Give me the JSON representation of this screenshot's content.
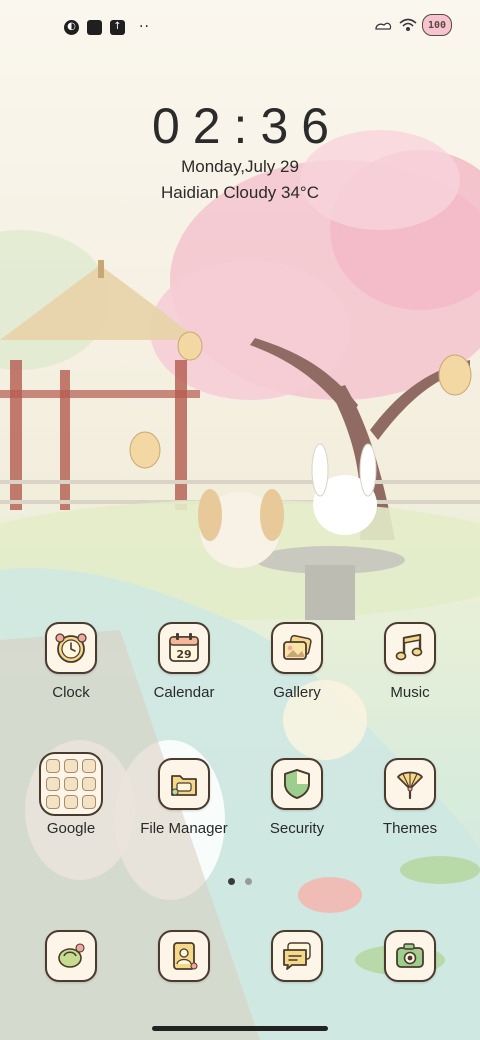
{
  "status_bar": {
    "left_icons": [
      "notification-app-icon",
      "square-app-icon",
      "upload-icon"
    ],
    "more_indicator": "··",
    "right_icons": [
      "signal-icon",
      "wifi-icon",
      "battery-icon"
    ],
    "battery_level": "100"
  },
  "clock_widget": {
    "time": "02:36",
    "date": "Monday,July 29",
    "weather": "Haidian Cloudy 34°C"
  },
  "apps": [
    {
      "label": "Clock",
      "icon": "alarm-clock-icon"
    },
    {
      "label": "Calendar",
      "icon": "calendar-icon",
      "badge": "29"
    },
    {
      "label": "Gallery",
      "icon": "gallery-icon"
    },
    {
      "label": "Music",
      "icon": "music-note-icon"
    },
    {
      "label": "Google",
      "icon": "folder-icon"
    },
    {
      "label": "File Manager",
      "icon": "file-folder-icon"
    },
    {
      "label": "Security",
      "icon": "shield-icon"
    },
    {
      "label": "Themes",
      "icon": "fan-icon"
    }
  ],
  "dock": [
    {
      "icon": "phone-icon"
    },
    {
      "icon": "contacts-icon"
    },
    {
      "icon": "messages-icon"
    },
    {
      "icon": "camera-icon"
    }
  ],
  "page_indicator": {
    "pages": 2,
    "current": 1
  },
  "colors": {
    "icon_bg": "#fdf6e8",
    "icon_border": "#4a3b2f",
    "text": "#2a2a2a",
    "cherry_blossom": "#f4c4cf",
    "water": "#cfe8e2"
  }
}
